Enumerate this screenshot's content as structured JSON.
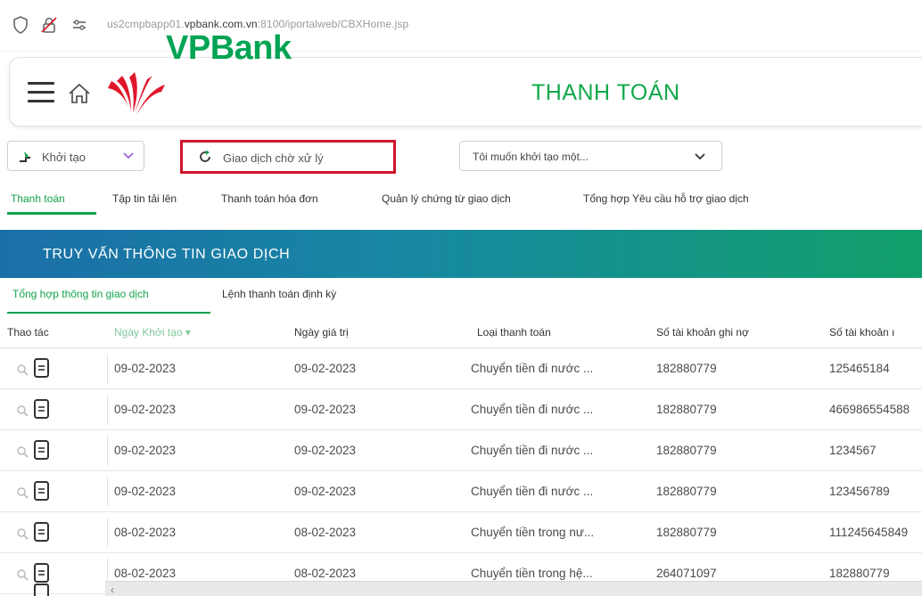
{
  "browser": {
    "url_prefix": "us2cmpbapp01.",
    "url_domain": "vpbank.com.vn",
    "url_suffix": ":8100/iportalweb/CBXHome.jsp"
  },
  "header": {
    "brand": "VPBank",
    "page_title": "THANH TOÁN",
    "brand_color": "#00a453",
    "logo_red": "#e0162b"
  },
  "toolbar": {
    "create_label": "Khởi tạo",
    "pending_label": "Giao dịch chờ xử lý",
    "select_value": "Tôi muốn khởi tạo một..."
  },
  "tabs": [
    {
      "label": "Thanh toán",
      "active": true
    },
    {
      "label": "Tập tin tải lên"
    },
    {
      "label": "Thanh toán hóa đơn"
    },
    {
      "label": "Quản lý chứng từ giao dịch"
    },
    {
      "label": "Tổng hợp Yêu cầu hỗ trợ giao dịch"
    }
  ],
  "banner": {
    "title": "TRUY VẤN THÔNG TIN GIAO DỊCH"
  },
  "subtabs": [
    {
      "label": "Tổng hợp thông tin giao dịch",
      "active": true
    },
    {
      "label": "Lệnh thanh toán định kỳ"
    }
  ],
  "table": {
    "columns": [
      "Thao tác",
      "Ngày Khởi tạo ▾",
      "Ngày giá trị",
      "Loại thanh toán",
      "Số tài khoản ghi nợ",
      "Số tài khoản ı"
    ],
    "rows": [
      [
        "09-02-2023",
        "09-02-2023",
        "Chuyển tiền đi nước ...",
        "182880779",
        "125465184"
      ],
      [
        "09-02-2023",
        "09-02-2023",
        "Chuyển tiền đi nước ...",
        "182880779",
        "466986554588"
      ],
      [
        "09-02-2023",
        "09-02-2023",
        "Chuyển tiền đi nước ...",
        "182880779",
        "1234567"
      ],
      [
        "09-02-2023",
        "09-02-2023",
        "Chuyển tiền đi nước ...",
        "182880779",
        "123456789"
      ],
      [
        "08-02-2023",
        "08-02-2023",
        "Chuyển tiền trong nư...",
        "182880779",
        "111245645849"
      ],
      [
        "08-02-2023",
        "08-02-2023",
        "Chuyển tiền trong hệ...",
        "264071097",
        "182880779"
      ]
    ]
  },
  "scrollbar": {
    "left_arrow": "‹"
  }
}
